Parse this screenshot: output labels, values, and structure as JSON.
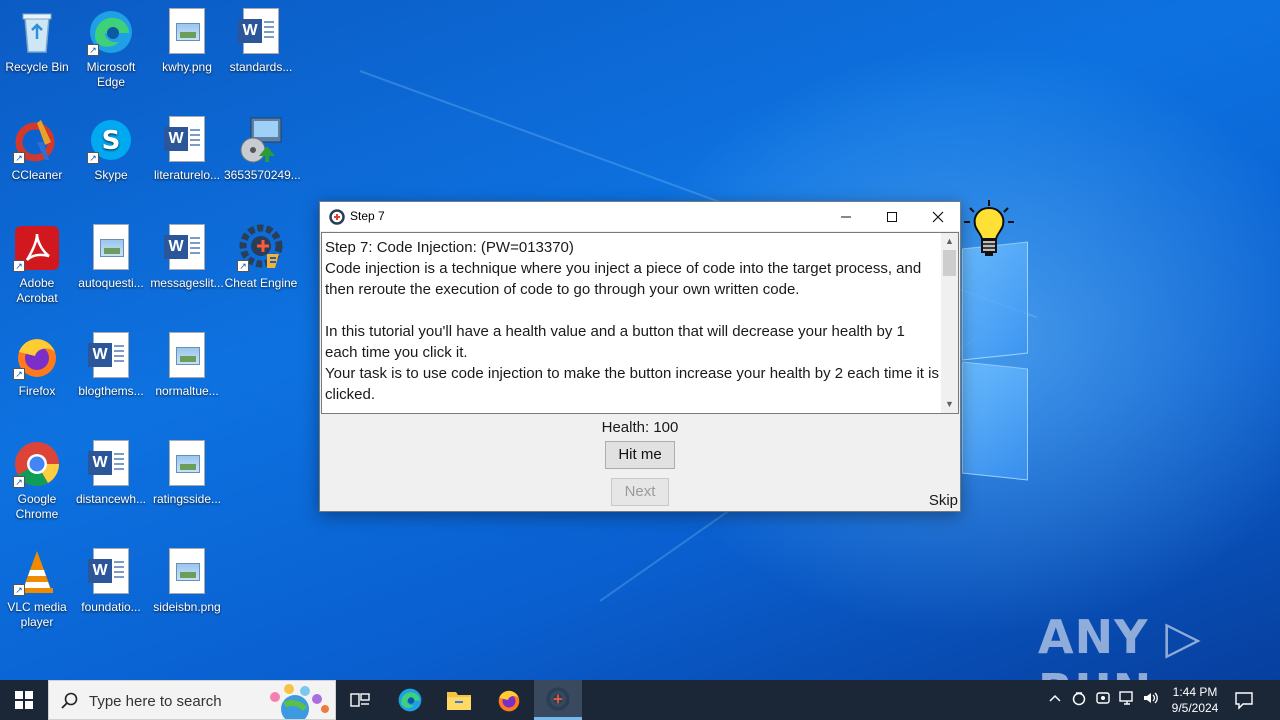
{
  "desktop": {
    "icons": [
      {
        "label": "Recycle Bin",
        "icon": "recycle-bin-icon"
      },
      {
        "label": "Microsoft Edge",
        "icon": "edge-icon"
      },
      {
        "label": "kwhy.png",
        "icon": "image-file-icon"
      },
      {
        "label": "standards...",
        "icon": "word-doc-icon"
      },
      {
        "label": "CCleaner",
        "icon": "ccleaner-icon"
      },
      {
        "label": "Skype",
        "icon": "skype-icon"
      },
      {
        "label": "literaturelo...",
        "icon": "word-doc-icon"
      },
      {
        "label": "3653570249...",
        "icon": "installer-icon"
      },
      {
        "label": "Adobe Acrobat",
        "icon": "acrobat-icon"
      },
      {
        "label": "autoquesti...",
        "icon": "image-file-icon"
      },
      {
        "label": "messageslit...",
        "icon": "word-doc-icon"
      },
      {
        "label": "Cheat Engine",
        "icon": "cheat-engine-icon"
      },
      {
        "label": "Firefox",
        "icon": "firefox-icon"
      },
      {
        "label": "blogthems...",
        "icon": "word-doc-icon"
      },
      {
        "label": "normaltue...",
        "icon": "image-file-icon"
      },
      {
        "label": "Google Chrome",
        "icon": "chrome-icon"
      },
      {
        "label": "distancewh...",
        "icon": "word-doc-icon"
      },
      {
        "label": "ratingsside...",
        "icon": "image-file-icon"
      },
      {
        "label": "VLC media player",
        "icon": "vlc-icon"
      },
      {
        "label": "foundatio...",
        "icon": "word-doc-icon"
      },
      {
        "label": "sideisbn.png",
        "icon": "image-file-icon"
      }
    ]
  },
  "window": {
    "title": "Step 7",
    "text": "Step 7: Code Injection: (PW=013370)\nCode injection is a technique where you inject a piece of code into the target process, and then reroute the execution of code to go through your own written code.\n\nIn this tutorial you'll have a health value and a button that will decrease your health by 1 each time you click it.\nYour task is to use code injection to make the button increase your health by 2 each time it is clicked.",
    "health_label": "Health: 100",
    "hit_button": "Hit me",
    "next_button": "Next",
    "skip_link": "Skip"
  },
  "watermark": "ANY RUN",
  "taskbar": {
    "search_placeholder": "Type here to search",
    "time": "1:44 PM",
    "date": "9/5/2024"
  }
}
